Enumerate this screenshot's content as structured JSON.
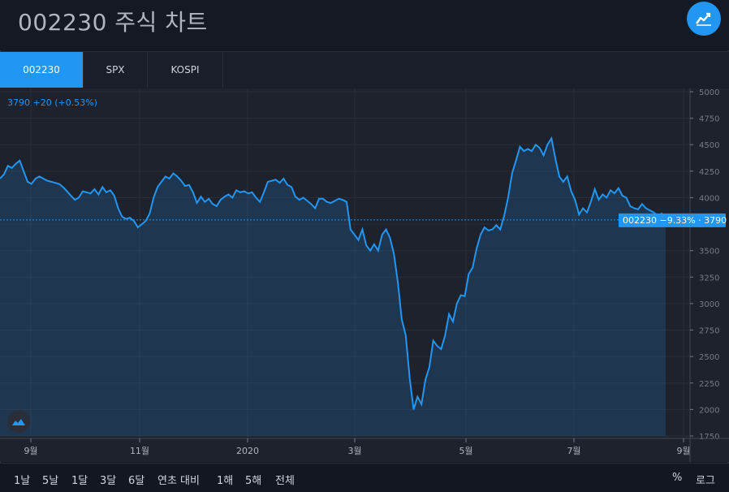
{
  "header": {
    "title": "002230 주식 차트",
    "brand_icon": "trending-chart-icon"
  },
  "tabs": [
    {
      "label": "002230",
      "active": true
    },
    {
      "label": "SPX",
      "active": false
    },
    {
      "label": "KOSPI",
      "active": false
    }
  ],
  "legend": {
    "last": "3790",
    "change": "+20",
    "change_pct": "(+0.53%)"
  },
  "price_label": {
    "name": "002230",
    "pct": "−9.33%",
    "value": "3790"
  },
  "footer": {
    "ranges": [
      "1날",
      "5날",
      "1달",
      "3달",
      "6달",
      "연초 대비",
      "1해",
      "5해",
      "전체"
    ],
    "percent": "%",
    "log": "로그"
  },
  "colors": {
    "accent": "#2196f3",
    "background": "#1e222d",
    "grid": "#2a2e39"
  },
  "chart_data": {
    "type": "area",
    "y_ticks": [
      1750,
      2000,
      2250,
      2500,
      2750,
      3000,
      3250,
      3500,
      3750,
      4000,
      4250,
      4500,
      4750,
      5000
    ],
    "ylim": [
      1750,
      5000
    ],
    "x_ticks": [
      "9월",
      "11월",
      "2020",
      "3월",
      "5월",
      "7월",
      "9월"
    ],
    "grid": true,
    "series": [
      {
        "values": [
          4180,
          4220,
          4300,
          4280,
          4320,
          4350,
          4250,
          4150,
          4130,
          4180,
          4200,
          4180,
          4160,
          4150,
          4140,
          4130,
          4100,
          4060,
          4020,
          3980,
          4000,
          4060,
          4050,
          4040,
          4080,
          4030,
          4100,
          4050,
          4070,
          4020,
          3900,
          3820,
          3800,
          3810,
          3780,
          3720,
          3750,
          3780,
          3850,
          4000,
          4100,
          4150,
          4200,
          4180,
          4230,
          4200,
          4160,
          4110,
          4120,
          4050,
          3950,
          4010,
          3960,
          3990,
          3940,
          3920,
          3980,
          4010,
          4030,
          4000,
          4070,
          4050,
          4060,
          4040,
          4050,
          4000,
          3960,
          4050,
          4150,
          4160,
          4170,
          4140,
          4180,
          4120,
          4100,
          4010,
          3980,
          4000,
          3970,
          3940,
          3900,
          3990,
          3990,
          3960,
          3950,
          3970,
          3990,
          3980,
          3960,
          3700,
          3650,
          3600,
          3700,
          3550,
          3500,
          3560,
          3500,
          3650,
          3700,
          3620,
          3470,
          3200,
          2850,
          2700,
          2300,
          2000,
          2120,
          2050,
          2280,
          2400,
          2650,
          2600,
          2570,
          2700,
          2900,
          2830,
          3000,
          3080,
          3070,
          3280,
          3340,
          3520,
          3650,
          3720,
          3690,
          3700,
          3740,
          3700,
          3830,
          4000,
          4230,
          4350,
          4480,
          4440,
          4460,
          4440,
          4500,
          4470,
          4400,
          4500,
          4560,
          4370,
          4200,
          4150,
          4200,
          4060,
          3980,
          3840,
          3900,
          3860,
          3960,
          4080,
          3980,
          4030,
          4000,
          4070,
          4040,
          4090,
          4020,
          4000,
          3920,
          3900,
          3890,
          3940,
          3900,
          3880,
          3860,
          3830,
          3850,
          3790
        ]
      }
    ]
  }
}
